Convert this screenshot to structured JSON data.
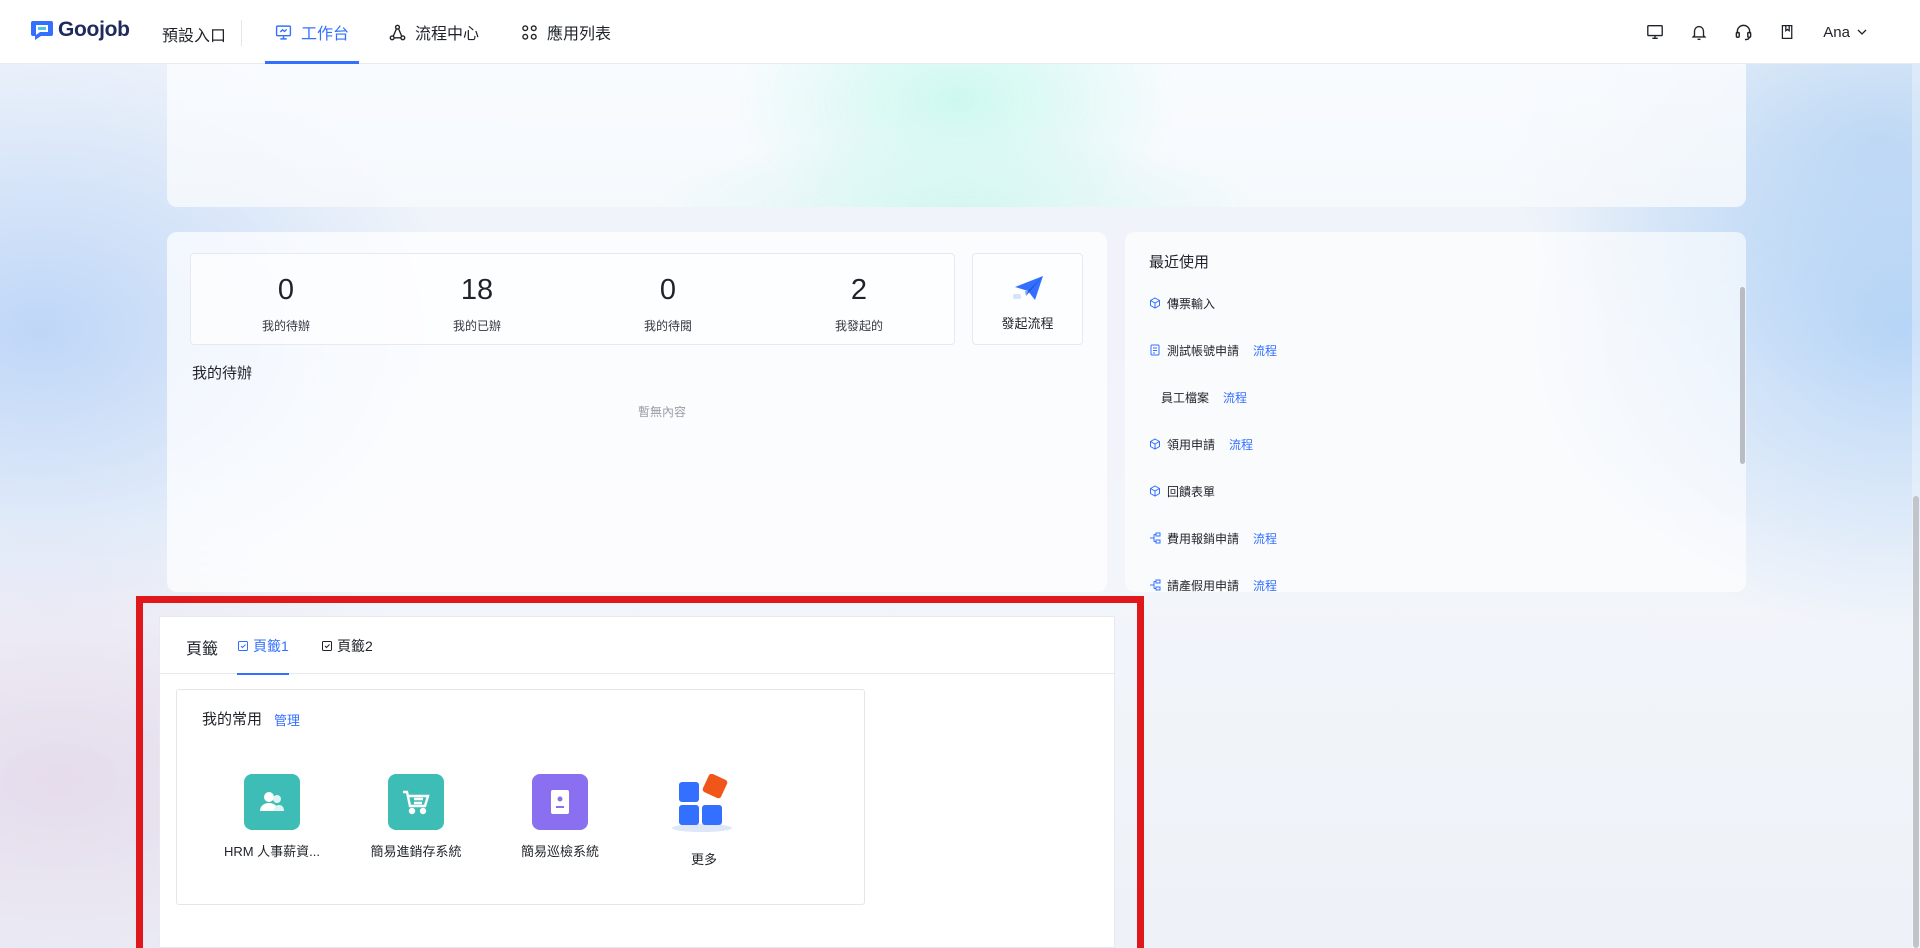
{
  "header": {
    "logo_text": "Goojob",
    "entry_label": "預設入口",
    "nav_tabs": [
      {
        "label": "工作台",
        "icon": "monitor-icon",
        "active": true
      },
      {
        "label": "流程中心",
        "icon": "workflow-icon",
        "active": false
      },
      {
        "label": "應用列表",
        "icon": "grid-icon",
        "active": false
      }
    ],
    "right_icons": [
      "desktop-icon",
      "bell-icon",
      "headset-icon",
      "book-icon"
    ],
    "user_name": "Ana"
  },
  "stats": [
    {
      "value": "0",
      "label": "我的待辦"
    },
    {
      "value": "18",
      "label": "我的已辦"
    },
    {
      "value": "0",
      "label": "我的待閱"
    },
    {
      "value": "2",
      "label": "我發起的"
    }
  ],
  "launch": {
    "label": "發起流程",
    "icon": "paper-plane-icon"
  },
  "todo": {
    "title": "我的待辦",
    "empty_text": "暫無內容"
  },
  "recent": {
    "title": "最近使用",
    "items": [
      {
        "label": "傳票輸入",
        "tag": "",
        "icon": "cube-icon"
      },
      {
        "label": "測試帳號申請",
        "tag": "流程",
        "icon": "form-icon"
      },
      {
        "label": "員工檔案",
        "tag": "流程",
        "icon": ""
      },
      {
        "label": "領用申請",
        "tag": "流程",
        "icon": "cube-icon"
      },
      {
        "label": "回饋表單",
        "tag": "",
        "icon": "cube-icon"
      },
      {
        "label": "費用報銷申請",
        "tag": "流程",
        "icon": "flow-icon"
      },
      {
        "label": "請產假用申請",
        "tag": "流程",
        "icon": "flow-icon"
      }
    ]
  },
  "bookmarks": {
    "title": "頁籤",
    "tabs": [
      {
        "label": "頁籤1",
        "active": true
      },
      {
        "label": "頁籤2",
        "active": false
      }
    ],
    "favorites": {
      "title": "我的常用",
      "manage_label": "管理",
      "apps": [
        {
          "label": "HRM 人事薪資...",
          "icon": "people-icon",
          "color": "#3dbdb5"
        },
        {
          "label": "簡易進銷存系統",
          "icon": "cart-icon",
          "color": "#3dbdb5"
        },
        {
          "label": "簡易巡檢系統",
          "icon": "id-card-icon",
          "color": "#8a6ff0"
        },
        {
          "label": "更多",
          "icon": "more-apps-icon",
          "color": "#3370ff"
        }
      ]
    }
  },
  "colors": {
    "accent": "#3370ff",
    "highlight": "#e0181b"
  }
}
